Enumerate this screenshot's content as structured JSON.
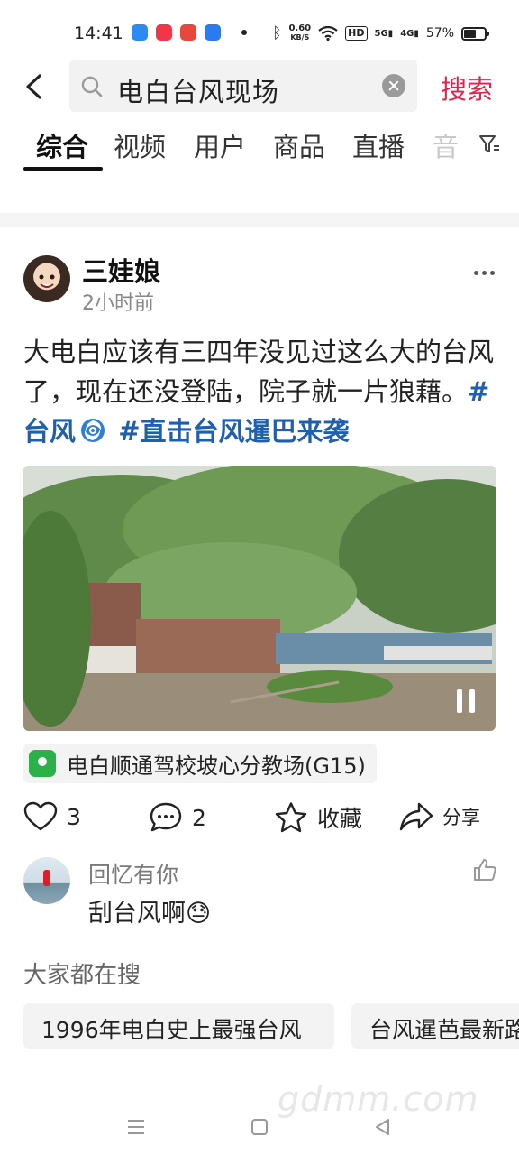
{
  "status_bar": {
    "time": "14:41",
    "net_speed_value": "0.60",
    "net_speed_unit": "KB/S",
    "hd_label": "HD",
    "signal_1": "5G",
    "signal_2": "4G",
    "battery_percent": "57%",
    "battery_level": 0.57,
    "app_icon_colors": [
      "#2a8cf0",
      "#f2364a",
      "#e8483b",
      "#2a7af0"
    ]
  },
  "search": {
    "query": "电白台风现场",
    "submit_label": "搜索"
  },
  "tabs": [
    {
      "label": "综合",
      "active": true
    },
    {
      "label": "视频",
      "active": false
    },
    {
      "label": "用户",
      "active": false
    },
    {
      "label": "商品",
      "active": false
    },
    {
      "label": "直播",
      "active": false
    },
    {
      "label": "音",
      "active": false
    }
  ],
  "post": {
    "author": "三娃娘",
    "time": "2小时前",
    "text": "大电白应该有三四年没见过这么大的台风了，现在还没登陆，院子就一片狼藉。",
    "hashtag_1": "#台风",
    "hashtag_2": "#直击台风暹巴来袭",
    "location": "电白顺通驾校坡心分教场(G15)",
    "likes": "3",
    "comments": "2",
    "favorite_label": "收藏",
    "share_label": "分享"
  },
  "comment": {
    "user": "回忆有你",
    "text": "刮台风啊😓"
  },
  "related": {
    "title": "大家都在搜",
    "items": [
      "1996年电白史上最强台风",
      "台风暹芭最新路"
    ]
  },
  "watermark": "gdmm.com",
  "colors": {
    "accent": "#e3234b",
    "hashtag": "#1f5fb0",
    "location_pin": "#2bb04a"
  }
}
